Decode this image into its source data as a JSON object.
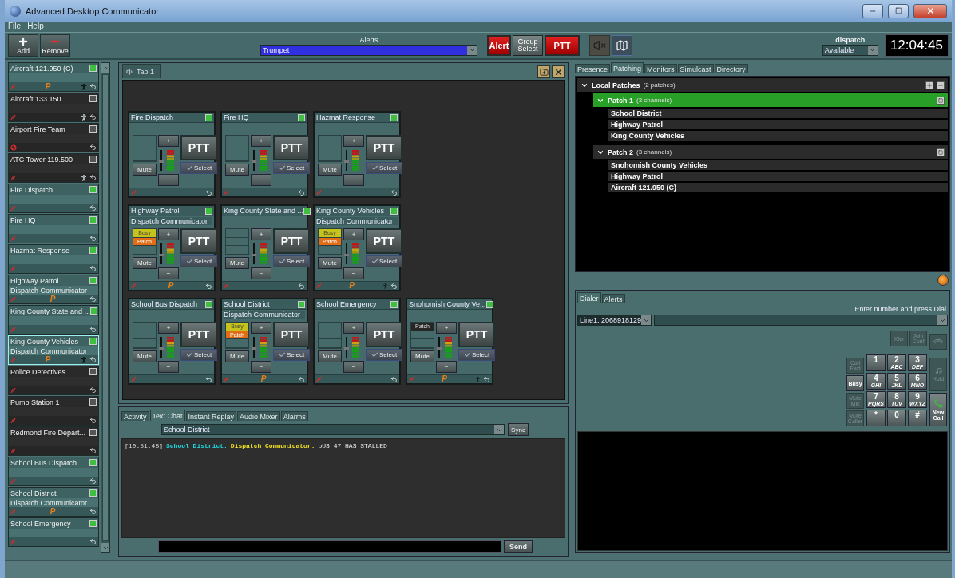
{
  "window": {
    "title": "Advanced Desktop Communicator"
  },
  "menu": [
    "File",
    "Help"
  ],
  "toolbar": {
    "add": "Add",
    "remove": "Remove",
    "alerts_label": "Alerts",
    "alert_sound": "Trumpet",
    "alert_button": "Alert",
    "group_select": "Group Select",
    "ptt": "PTT",
    "user": "dispatch",
    "status": "Available",
    "clock": "12:04:45"
  },
  "channels": [
    {
      "name": "Aircraft 121.950 (C)",
      "on": true,
      "selected": false,
      "mic_blocked": false,
      "patch_icon": "P",
      "walker": true
    },
    {
      "name": "Aircraft 133.150",
      "on": false,
      "selected": false,
      "mic_blocked": false,
      "walker": true
    },
    {
      "name": "Airport Fire Team",
      "on": false,
      "selected": false,
      "mic_blocked": true,
      "walker": false
    },
    {
      "name": "ATC Tower 119.500",
      "on": false,
      "selected": false,
      "mic_blocked": false,
      "walker": true
    },
    {
      "name": "Fire Dispatch",
      "on": true,
      "selected": false,
      "mic_blocked": false,
      "walker": false
    },
    {
      "name": "Fire HQ",
      "on": true,
      "selected": false,
      "mic_blocked": false,
      "walker": false
    },
    {
      "name": "Hazmat Response",
      "on": true,
      "selected": false,
      "mic_blocked": false,
      "walker": false
    },
    {
      "name": "Highway Patrol",
      "subtitle": "Dispatch Communicator",
      "on": true,
      "selected": false,
      "mic_blocked": false,
      "patch_icon": "P",
      "walker": false
    },
    {
      "name": "King County State and ...",
      "on": true,
      "selected": false,
      "mic_blocked": false,
      "walker": false
    },
    {
      "name": "King County Vehicles",
      "subtitle": "Dispatch Communicator",
      "on": true,
      "selected": true,
      "mic_blocked": false,
      "patch_icon": "P",
      "walker": true
    },
    {
      "name": "Police Detectives",
      "on": false,
      "selected": false,
      "mic_blocked": false,
      "walker": false
    },
    {
      "name": "Pump Station 1",
      "on": false,
      "selected": false,
      "mic_blocked": false,
      "walker": false
    },
    {
      "name": "Redmond Fire Depart...",
      "on": false,
      "selected": false,
      "mic_blocked": false,
      "walker": false
    },
    {
      "name": "School Bus Dispatch",
      "on": true,
      "selected": false,
      "mic_blocked": false,
      "walker": false
    },
    {
      "name": "School District",
      "subtitle": "Dispatch Communicator",
      "on": true,
      "selected": false,
      "mic_blocked": false,
      "patch_icon": "P",
      "walker": false
    },
    {
      "name": "School Emergency",
      "on": true,
      "selected": false,
      "mic_blocked": false,
      "walker": false
    }
  ],
  "workspace_tabs": [
    {
      "label": "Tab 1",
      "selected": true
    }
  ],
  "card_rows": [
    [
      {
        "title": "Fire Dispatch",
        "on": true,
        "walker": false,
        "buttons": [
          "+",
          "−",
          "PTT",
          "Mute",
          "Select"
        ]
      },
      {
        "title": "Fire HQ",
        "on": true,
        "walker": false,
        "buttons": [
          "+",
          "−",
          "PTT",
          "Mute",
          "Select"
        ]
      },
      {
        "title": "Hazmat Response",
        "on": true,
        "walker": false,
        "buttons": [
          "+",
          "−",
          "PTT",
          "Mute",
          "Select"
        ]
      }
    ],
    [
      {
        "title": "Highway Patrol",
        "subtitle": "Dispatch Communicator",
        "on": true,
        "flags": [
          {
            "label": "Busy",
            "kind": "busy"
          },
          {
            "label": "Patch",
            "kind": "patch"
          }
        ],
        "patch_icon": "P",
        "walker": false,
        "buttons": [
          "+",
          "−",
          "PTT",
          "Mute",
          "Select"
        ]
      },
      {
        "title": "King County State and ...",
        "on": true,
        "walker": false,
        "buttons": [
          "+",
          "−",
          "PTT",
          "Mute",
          "Select"
        ]
      },
      {
        "title": "King County Vehicles",
        "subtitle": "Dispatch Communicator",
        "on": true,
        "flags": [
          {
            "label": "Busy",
            "kind": "busy"
          },
          {
            "label": "Patch",
            "kind": "patch"
          }
        ],
        "patch_icon": "P",
        "walker": true,
        "buttons": [
          "+",
          "−",
          "PTT",
          "Mute",
          "Select"
        ]
      }
    ],
    [
      {
        "title": "School Bus Dispatch",
        "on": true,
        "walker": false,
        "buttons": [
          "+",
          "−",
          "PTT",
          "Mute",
          "Select"
        ]
      },
      {
        "title": "School District",
        "subtitle": "Dispatch Communicator",
        "on": true,
        "flags": [
          {
            "label": "Busy",
            "kind": "busy"
          },
          {
            "label": "Patch",
            "kind": "patch"
          }
        ],
        "patch_icon": "P",
        "walker": false,
        "buttons": [
          "+",
          "−",
          "PTT",
          "Mute",
          "Select"
        ]
      },
      {
        "title": "School Emergency",
        "on": true,
        "walker": false,
        "buttons": [
          "+",
          "−",
          "PTT",
          "Mute",
          "Select"
        ]
      },
      {
        "title": "Snohomish County Ve...",
        "on": true,
        "flags": [
          {
            "label": "Patch",
            "kind": "patch-idle"
          }
        ],
        "patch_icon": "P",
        "walker": true,
        "buttons": [
          "+",
          "−",
          "PTT",
          "Mute",
          "Select"
        ]
      }
    ]
  ],
  "bottom_tabs": [
    {
      "label": "Activity",
      "selected": false
    },
    {
      "label": "Text Chat",
      "selected": true
    },
    {
      "label": "Instant Replay",
      "selected": false
    },
    {
      "label": "Audio Mixer",
      "selected": false
    },
    {
      "label": "Alarms",
      "selected": false
    }
  ],
  "chat": {
    "channel": "School District",
    "sync": "Sync",
    "messages": [
      {
        "time": "[10:51:45]",
        "channel": "School District:",
        "user": "Dispatch Communicator:",
        "text": "bUS 47 HAS STALLED"
      }
    ],
    "send": "Send"
  },
  "right_tabs": [
    {
      "label": "Presence",
      "selected": false
    },
    {
      "label": "Patching",
      "selected": true
    },
    {
      "label": "Monitors",
      "selected": false
    },
    {
      "label": "Simulcast",
      "selected": false
    },
    {
      "label": "Directory",
      "selected": false
    }
  ],
  "patch_tree": {
    "label": "Local Patches",
    "note": "(2 patches)",
    "expanded": true,
    "children": [
      {
        "label": "Patch 1",
        "note": "(3 channels)",
        "selected": true,
        "expanded": true,
        "children": [
          "School District",
          "Highway Patrol",
          "King County Vehicles"
        ]
      },
      {
        "label": "Patch 2",
        "note": "(3 channels)",
        "selected": false,
        "expanded": true,
        "children": [
          "Snohomish County Vehicles",
          "Highway Patrol",
          "Aircraft 121.950 (C)"
        ]
      }
    ]
  },
  "dialer_tabs": [
    {
      "label": "Dialer",
      "selected": true
    },
    {
      "label": "Alerts",
      "selected": false
    }
  ],
  "dialer": {
    "hint": "Enter number and press Dial",
    "line": "Line1: 2068918129",
    "top_buttons": [
      {
        "label": "Xfer",
        "disabled": true
      },
      {
        "label": "Join Conf",
        "disabled": true
      }
    ],
    "side_buttons": [
      {
        "label": "Call Fwd",
        "disabled": true
      },
      {
        "label": "Busy",
        "disabled": false
      },
      {
        "label": "Mute Mic",
        "disabled": true
      },
      {
        "label": "Mute Caller",
        "disabled": true
      }
    ],
    "keys": [
      {
        "digit": "1"
      },
      {
        "digit": "2",
        "letters": "ABC"
      },
      {
        "digit": "3",
        "letters": "DEF"
      },
      {
        "digit": "4",
        "letters": "GHI"
      },
      {
        "digit": "5",
        "letters": "JKL"
      },
      {
        "digit": "6",
        "letters": "MNO"
      },
      {
        "digit": "7",
        "letters": "PQRS"
      },
      {
        "digit": "8",
        "letters": "TUV"
      },
      {
        "digit": "9",
        "letters": "WXYZ"
      },
      {
        "digit": "*"
      },
      {
        "digit": "0"
      },
      {
        "digit": "#"
      }
    ],
    "hold": {
      "label": "Hold",
      "disabled": true
    },
    "new_call": "New Call"
  }
}
